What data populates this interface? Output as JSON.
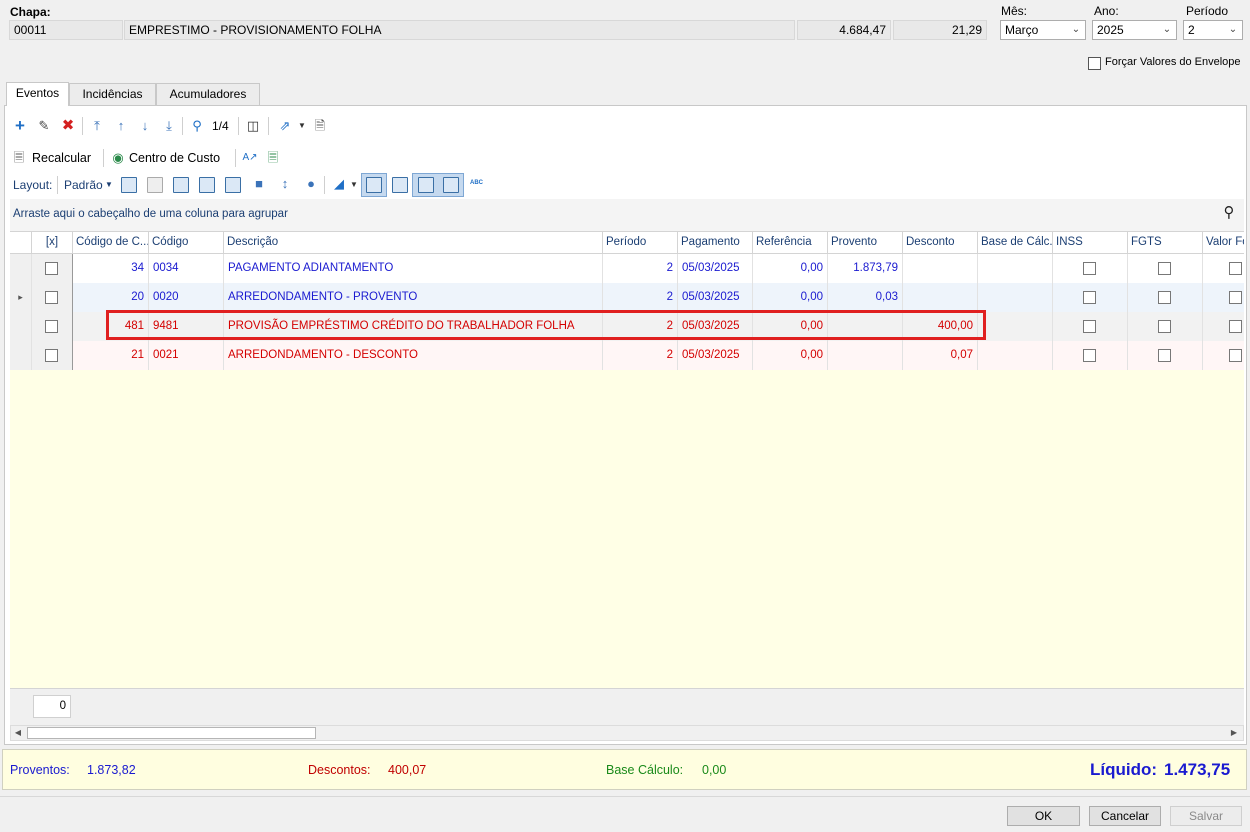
{
  "header": {
    "chapa_label": "Chapa:",
    "chapa_code": "00011",
    "chapa_name": "EMPRESTIMO - PROVISIONAMENTO FOLHA",
    "value1": "4.684,47",
    "value2": "21,29",
    "mes_label": "Mês:",
    "mes_value": "Março",
    "ano_label": "Ano:",
    "ano_value": "2025",
    "periodo_label": "Período",
    "periodo_value": "2",
    "forcar_label": "Forçar Valores do Envelope"
  },
  "tabs": [
    {
      "label": "Eventos"
    },
    {
      "label": "Incidências"
    },
    {
      "label": "Acumuladores"
    }
  ],
  "toolbar": {
    "record_counter": "1/4",
    "recalcular": "Recalcular",
    "centro_custo": "Centro de Custo",
    "layout_label": "Layout:",
    "layout_value": "Padrão",
    "group_hint": "Arraste aqui o cabeçalho de uma coluna para agrupar"
  },
  "columns": [
    "[x]",
    "Código de C...",
    "Código",
    "Descrição",
    "Período",
    "Pagamento",
    "Referência",
    "Provento",
    "Desconto",
    "Base de Cálc...",
    "INSS",
    "FGTS",
    "Valor Fo"
  ],
  "rows": [
    {
      "cod_c": "34",
      "codigo": "0034",
      "descricao": "PAGAMENTO ADIANTAMENTO",
      "periodo": "2",
      "pagamento": "05/03/2025",
      "referencia": "0,00",
      "provento": "1.873,79",
      "desconto": "",
      "type": "provento"
    },
    {
      "cod_c": "20",
      "codigo": "0020",
      "descricao": "ARREDONDAMENTO - PROVENTO",
      "periodo": "2",
      "pagamento": "05/03/2025",
      "referencia": "0,00",
      "provento": "0,03",
      "desconto": "",
      "type": "provento"
    },
    {
      "cod_c": "481",
      "codigo": "9481",
      "descricao": "PROVISÃO EMPRÉSTIMO CRÉDITO DO TRABALHADOR FOLHA",
      "periodo": "2",
      "pagamento": "05/03/2025",
      "referencia": "0,00",
      "provento": "",
      "desconto": "400,00",
      "type": "desconto"
    },
    {
      "cod_c": "21",
      "codigo": "0021",
      "descricao": "ARREDONDAMENTO - DESCONTO",
      "periodo": "2",
      "pagamento": "05/03/2025",
      "referencia": "0,00",
      "provento": "",
      "desconto": "0,07",
      "type": "desconto"
    }
  ],
  "grid_footer": {
    "count": "0"
  },
  "totals": {
    "proventos_label": "Proventos:",
    "proventos_value": "1.873,82",
    "descontos_label": "Descontos:",
    "descontos_value": "400,07",
    "base_label": "Base Cálculo:",
    "base_value": "0,00",
    "liquido_label": "Líquido:",
    "liquido_value": "1.473,75"
  },
  "buttons": {
    "ok": "OK",
    "cancelar": "Cancelar",
    "salvar": "Salvar"
  },
  "colors": {
    "provento": "#1a1ad0",
    "desconto": "#d40000",
    "highlight": "#e02020",
    "base": "#1a8a1a"
  }
}
